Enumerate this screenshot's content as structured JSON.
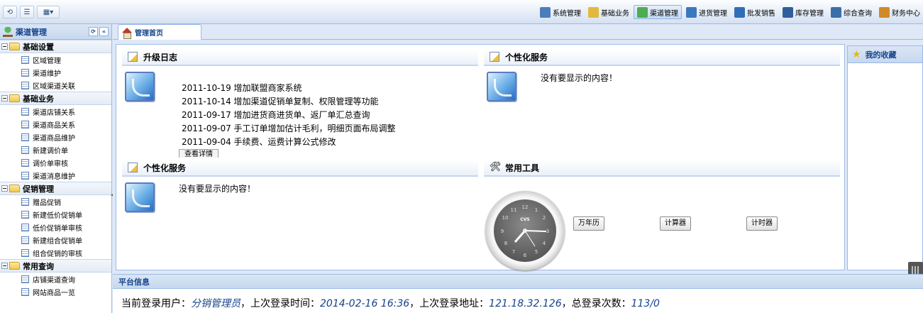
{
  "menu": [
    {
      "label": "系统管理",
      "icon": "gear-icon",
      "color": "#4a7ebb",
      "active": false
    },
    {
      "label": "基础业务",
      "icon": "note-icon",
      "color": "#e2b93b",
      "active": false
    },
    {
      "label": "渠道管理",
      "icon": "plant-icon",
      "color": "#4cae4c",
      "active": true
    },
    {
      "label": "进货管理",
      "icon": "cart-icon",
      "color": "#3a78c2",
      "active": false
    },
    {
      "label": "批发销售",
      "icon": "bag-icon",
      "color": "#2f6fb7",
      "active": false
    },
    {
      "label": "库存管理",
      "icon": "monitor-icon",
      "color": "#2f5f9a",
      "active": false
    },
    {
      "label": "综合查询",
      "icon": "magnifier-icon",
      "color": "#3c6fa8",
      "active": false
    },
    {
      "label": "财务中心",
      "icon": "finance-icon",
      "color": "#d08a2a",
      "active": false
    }
  ],
  "sidebar": {
    "title": "渠道管理",
    "groups": [
      {
        "label": "基础设置",
        "items": [
          "区域管理",
          "渠道维护",
          "区域渠道关联"
        ]
      },
      {
        "label": "基础业务",
        "items": [
          "渠道店铺关系",
          "渠道商品关系",
          "渠道商品维护",
          "新建调价单",
          "调价单审核",
          "渠道消息维护"
        ]
      },
      {
        "label": "促销管理",
        "items": [
          "赠品促销",
          "新建低价促销单",
          "低价促销单审核",
          "新建组合促销单",
          "组合促销的审核"
        ]
      },
      {
        "label": "常用查询",
        "items": [
          "店铺渠道查询",
          "网站商品一览"
        ]
      }
    ]
  },
  "tab": {
    "label": "管理首页"
  },
  "panels": {
    "upgrade": {
      "title": "升级日志",
      "entries": [
        "2011-10-19 增加联盟商家系统",
        "2011-10-14 增加渠道促销单复制、权限管理等功能",
        "2011-09-17 增加进货商进货单、返厂单汇总查询",
        "2011-09-07 手工订单增加估计毛利，明细页面布局调整",
        "2011-09-04 手续费、运费计算公式修改"
      ],
      "view_more": "查看详情"
    },
    "personal1": {
      "title": "个性化服务",
      "empty": "没有要显示的内容！"
    },
    "personal2": {
      "title": "个性化服务",
      "empty": "没有要显示的内容！"
    },
    "tools": {
      "title": "常用工具",
      "clock_brand": "CVS",
      "buttons": [
        "万年历",
        "计算器",
        "计时器"
      ]
    }
  },
  "favorites": {
    "title": "我的收藏"
  },
  "platform": {
    "title": "平台信息",
    "label_user": "当前登录用户：",
    "user": "分销管理员",
    "label_time": "，上次登录时间：",
    "time": "2014-02-16 16:36",
    "label_addr": "，上次登录地址：",
    "addr": "121.18.32.126",
    "label_count": "，总登录次数：",
    "count": "113/0"
  }
}
